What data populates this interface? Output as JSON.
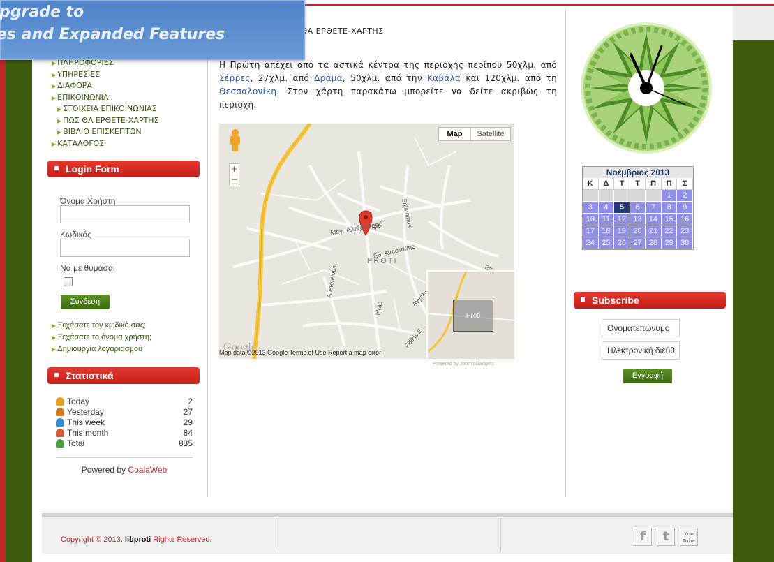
{
  "promo": {
    "line1": "pgrade to",
    "line2": "es and Expanded Features"
  },
  "breadcrumb": "Σ ΘΑ ΕΡΘΕΤΕ-ΧΑΡΤΗΣ",
  "menu": {
    "items": [
      {
        "label": "ΠΛΗΡΟΦΟΡΙΕΣ",
        "sub": false
      },
      {
        "label": "ΥΠΗΡΕΣΙΕΣ",
        "sub": false
      },
      {
        "label": "ΔΙΑΦΟΡΑ",
        "sub": false
      },
      {
        "label": "ΕΠΙΚΟΙΝΩΝΙΑ",
        "sub": false
      },
      {
        "label": "ΣΤΟΙΧΕΙΑ ΕΠΙΚΟΙΝΩΝΙΑΣ",
        "sub": true
      },
      {
        "label": "ΠΩΣ ΘΑ ΕΡΘΕΤΕ-ΧΑΡΤΗΣ",
        "sub": true
      },
      {
        "label": "ΒΙΒΛΙΟ ΕΠΙΣΚΕΠΤΩΝ",
        "sub": true
      },
      {
        "label": "ΚΑΤΑΛΟΓΟΣ",
        "sub": false
      }
    ]
  },
  "login": {
    "header": "Login Form",
    "username_label": "Όνομα Χρήστη",
    "password_label": "Κωδικός",
    "remember_label": "Να με θυμάσαι",
    "submit_label": "Σύνδεση",
    "links": [
      "Ξεχάσατε τον κωδικό σας;",
      "Ξεχάσατε το όνομα χρήστη;",
      "Δημιουργία λογαριασμού"
    ]
  },
  "stats": {
    "header": "Στατιστικά",
    "rows": [
      {
        "label": "Today",
        "value": "2",
        "color": "#e6a020"
      },
      {
        "label": "Yesterday",
        "value": "27",
        "color": "#d77a1a"
      },
      {
        "label": "This week",
        "value": "29",
        "color": "#3a8ad0"
      },
      {
        "label": "This month",
        "value": "84",
        "color": "#d05a3a"
      },
      {
        "label": "Total",
        "value": "835",
        "color": "#4aa040"
      }
    ],
    "powered_prefix": "Powered by ",
    "powered_link": "CoalaWeb"
  },
  "content": {
    "p1": "Η Πρώτη απέχει από τα αστικά κέντρα της περιοχής περίπου 50χλμ. από ",
    "l1": "Σέρρες",
    "p2": ", 27χλμ. από ",
    "l2": "Δράμα",
    "p3": ", 50χλμ. από την ",
    "l3": "Καβάλα",
    "p4": " και 120χλμ. από τη ",
    "l4": "Θεσσαλονίκη",
    "p5": ". Στον χάρτη παρακάτω μπορείτε να δείτε ακριβώς τη περιοχή."
  },
  "map": {
    "map_btn": "Map",
    "satellite_btn": "Satellite",
    "town": "PROTI",
    "streets": [
      "Μεγ. Αλεξάνδρου",
      "Εθ. Αντίστασης",
      "Salaminos",
      "Αρ...",
      "Aristotelous",
      "Idras",
      "Αγγελική",
      "Fillikis E...",
      "Em..."
    ],
    "inset_label": "Proti",
    "google": "Google",
    "credit": "Map data ©2013 Google  Terms of Use   Report a map error",
    "powered": "Powered by JoomlaGadgets"
  },
  "calendar": {
    "title": "Νοέμβριος 2013",
    "headers": [
      "Κ",
      "Δ",
      "Τ",
      "Τ",
      "Π",
      "Π",
      "Σ"
    ],
    "days": [
      "",
      "",
      "",
      "",
      "",
      "1",
      "2",
      "3",
      "4",
      "5",
      "6",
      "7",
      "8",
      "9",
      "10",
      "11",
      "12",
      "13",
      "14",
      "15",
      "16",
      "17",
      "18",
      "19",
      "20",
      "21",
      "22",
      "23",
      "24",
      "25",
      "26",
      "27",
      "28",
      "29",
      "30"
    ],
    "today": "5"
  },
  "subscribe": {
    "header": "Subscribe",
    "name_placeholder": "Ονοματεπώνυμο",
    "email_placeholder": "Ηλεκτρονική διεύθ",
    "submit_label": "Εγγραφή"
  },
  "footer": {
    "copyright_prefix": "Copyright © 2013. ",
    "site": "libproti",
    "copyright_suffix": " Rights Reserved.",
    "social": [
      "f",
      "t",
      "You Tube"
    ]
  }
}
